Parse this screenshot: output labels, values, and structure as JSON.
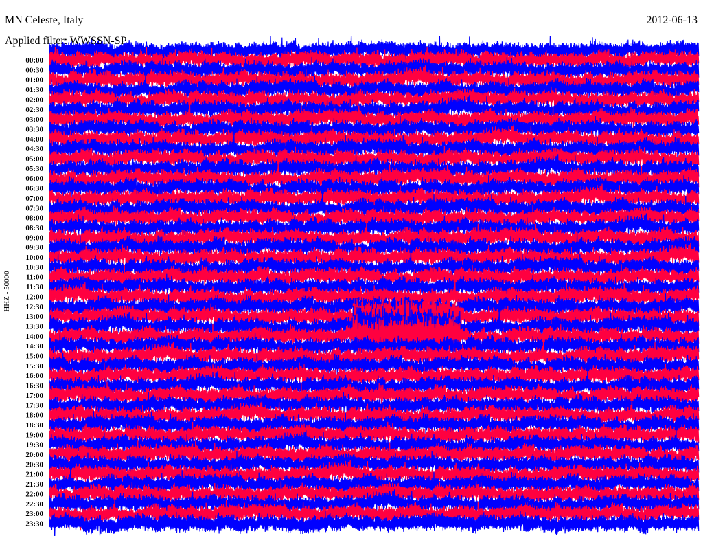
{
  "header": {
    "station": "MN Celeste, Italy",
    "date": "2012-06-13",
    "filter": "Applied filter: WWSSN-SP"
  },
  "chart_data": {
    "type": "line",
    "title": "MN Celeste, Italy",
    "subtitle": "Applied filter: WWSSN-SP",
    "ylabel": "HHZ - 50000",
    "xlabel": "",
    "row_minutes": 30,
    "row_labels": [
      "00:00",
      "00:30",
      "01:00",
      "01:30",
      "02:00",
      "02:30",
      "03:00",
      "03:30",
      "04:00",
      "04:30",
      "05:00",
      "05:30",
      "06:00",
      "06:30",
      "07:00",
      "07:30",
      "08:00",
      "08:30",
      "09:00",
      "09:30",
      "10:00",
      "10:30",
      "11:00",
      "11:30",
      "12:00",
      "12:30",
      "13:00",
      "13:30",
      "14:00",
      "14:30",
      "15:00",
      "15:30",
      "16:00",
      "16:30",
      "17:00",
      "17:30",
      "18:00",
      "18:30",
      "19:00",
      "19:30",
      "20:00",
      "20:30",
      "21:00",
      "21:30",
      "22:00",
      "22:30",
      "23:00",
      "23:30"
    ],
    "series_colors": [
      "#ff0040",
      "#0000ff"
    ],
    "event": {
      "rows": [
        "13:00",
        "13:30",
        "14:00"
      ],
      "start_minute": 14,
      "end_minute": 19,
      "amplitude_factor": 2.2
    },
    "grid": false
  }
}
